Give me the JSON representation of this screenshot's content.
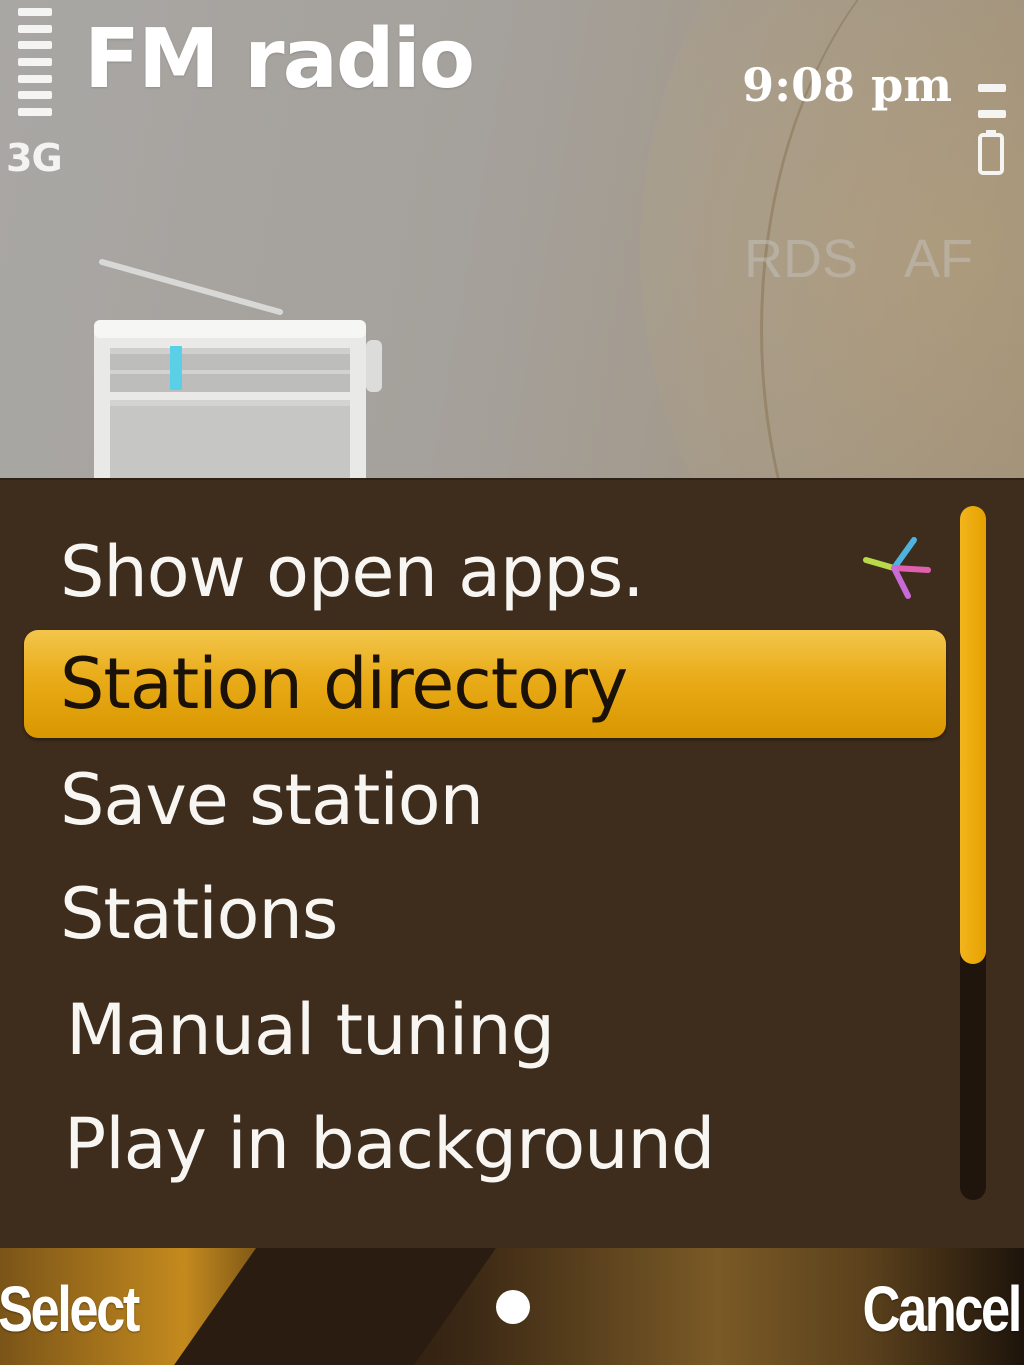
{
  "status_bar": {
    "network": "3G",
    "time": "9:08 pm",
    "signal_level": 1.0,
    "battery_level": 0.4
  },
  "app": {
    "title": "FM radio",
    "rds_label": "RDS",
    "af_label": "AF"
  },
  "options_menu": {
    "items": [
      {
        "label": "Show open apps.",
        "icon": "open-apps-icon"
      },
      {
        "label": "Station directory",
        "highlighted": true
      },
      {
        "label": "Save station"
      },
      {
        "label": "Stations"
      },
      {
        "label": "Manual tuning"
      },
      {
        "label": "Play in background"
      }
    ],
    "scroll_position_fraction": 0.0,
    "scroll_visible_fraction": 0.66
  },
  "softkeys": {
    "left": "Select",
    "center_icon": "selection-dot-icon",
    "right": "Cancel"
  },
  "colors": {
    "highlight": "#e9ab18",
    "menu_background": "#3e2c1c",
    "scroll_thumb": "#f2b51c"
  }
}
